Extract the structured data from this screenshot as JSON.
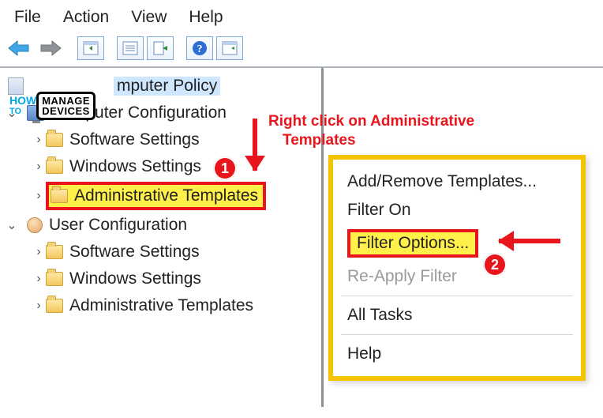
{
  "menu": {
    "file": "File",
    "action": "Action",
    "view": "View",
    "help": "Help"
  },
  "tree": {
    "root": "mputer Policy",
    "cc": "Computer Configuration",
    "cc_soft": "Software Settings",
    "cc_win": "Windows Settings",
    "cc_admin": "Administrative Templates",
    "uc": "User Configuration",
    "uc_soft": "Software Settings",
    "uc_win": "Windows Settings",
    "uc_admin": "Administrative Templates"
  },
  "ctx": {
    "addremove": "Add/Remove Templates...",
    "filteron": "Filter On",
    "filteropts": "Filter Options...",
    "reapply": "Re-Apply Filter",
    "alltasks": "All Tasks",
    "help": "Help"
  },
  "anno": {
    "instruction_l1": "Right click on Administrative",
    "instruction_l2": "Templates",
    "b1": "1",
    "b2": "2"
  },
  "wm": {
    "how": "HOW",
    "to": "TO",
    "manage": "MANAGE",
    "devices": "DEVICES"
  }
}
